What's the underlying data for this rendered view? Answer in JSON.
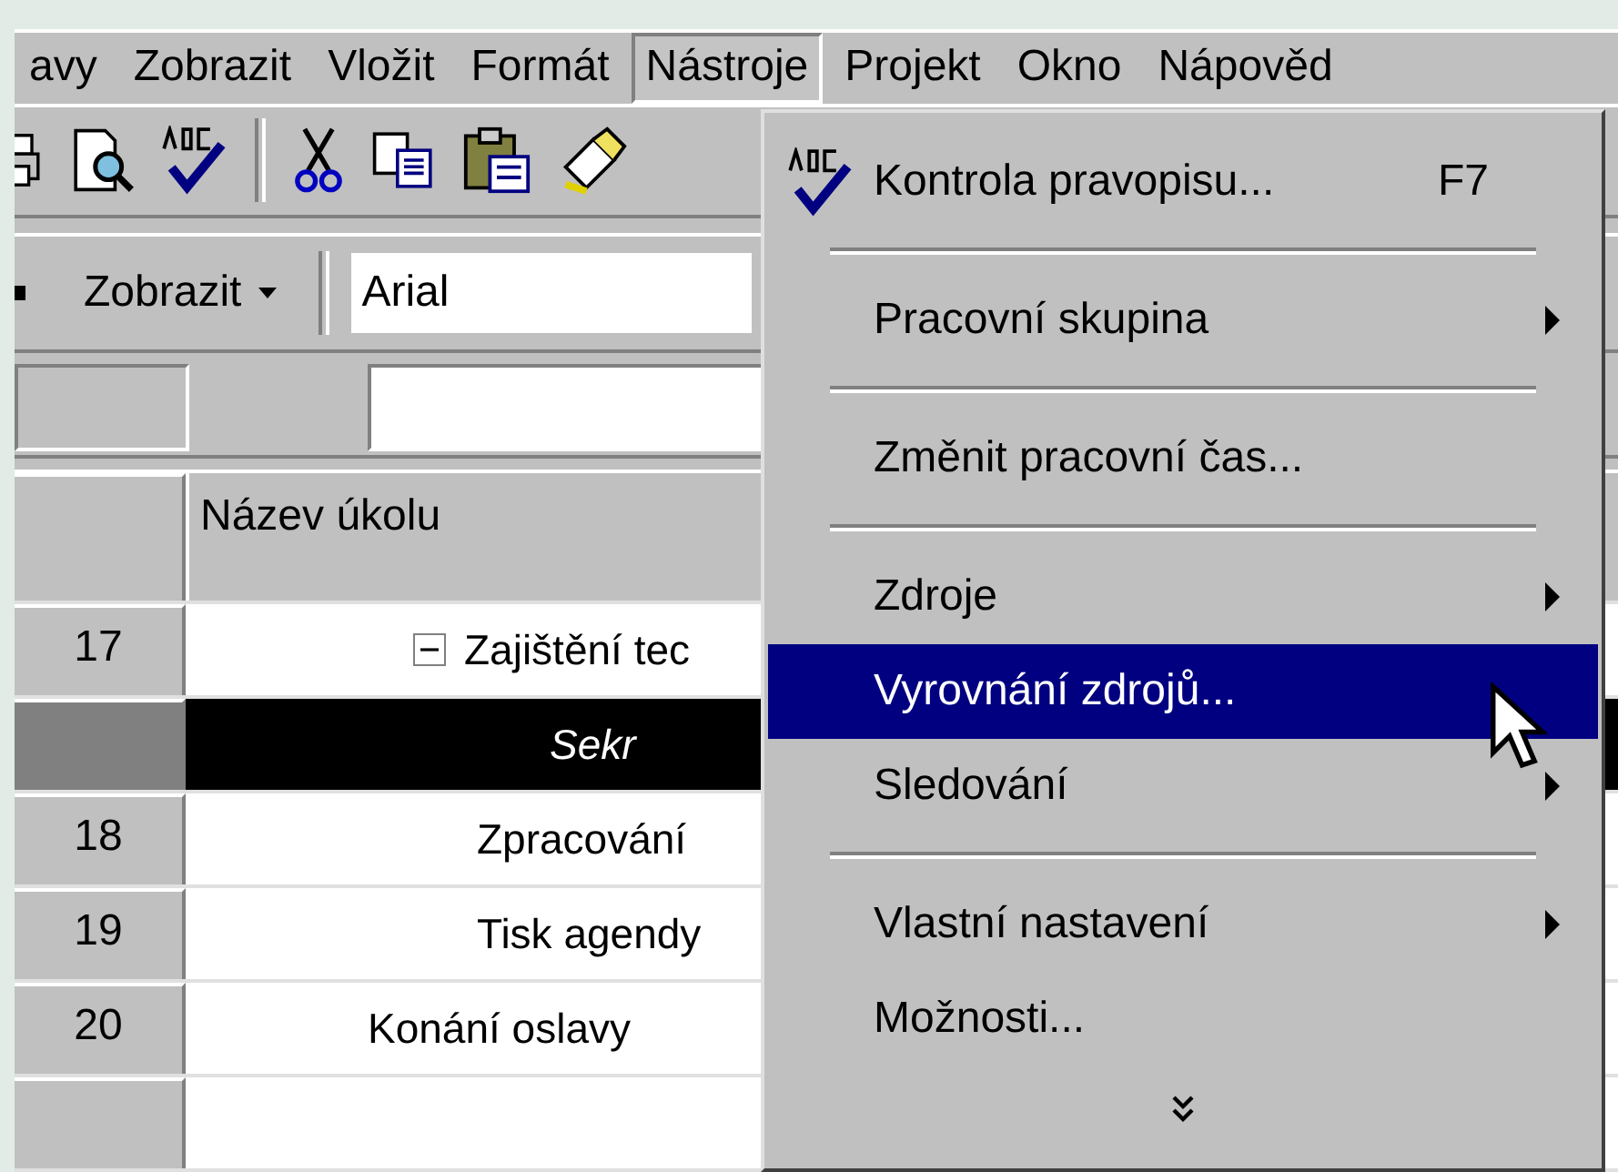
{
  "menu_bar": [
    {
      "label": "avy",
      "selected": false
    },
    {
      "label": "Zobrazit",
      "selected": false
    },
    {
      "label": "Vložit",
      "selected": false
    },
    {
      "label": "Formát",
      "selected": false
    },
    {
      "label": "Nástroje",
      "selected": true
    },
    {
      "label": "Projekt",
      "selected": false
    },
    {
      "label": "Okno",
      "selected": false
    },
    {
      "label": "Nápověd",
      "selected": false
    }
  ],
  "formatting_toolbar": {
    "view_button": "Zobrazit",
    "font_field": {
      "value": "Arial"
    }
  },
  "table": {
    "columns": [
      "Název úkolu"
    ],
    "rows": [
      {
        "id": "17",
        "name": "Zajištění tec",
        "selected": false,
        "expanded": true,
        "children": [
          {
            "name": "Sekr",
            "selected": true,
            "kind": "assignment"
          },
          {
            "id": "18",
            "name": "Zpracování",
            "selected": false
          },
          {
            "id": "19",
            "name": "Tisk agendy",
            "selected": false
          }
        ]
      },
      {
        "id": "20",
        "name": "Konání oslavy",
        "selected": false
      }
    ]
  },
  "tools_menu": {
    "items": [
      {
        "kind": "command",
        "label": "Kontrola pravopisu...",
        "shortcut": "F7",
        "icon": true,
        "selected": false
      },
      {
        "kind": "separator"
      },
      {
        "kind": "submenu",
        "label": "Pracovní skupina",
        "selected": false
      },
      {
        "kind": "separator"
      },
      {
        "kind": "command",
        "label": "Změnit pracovní čas...",
        "selected": false
      },
      {
        "kind": "separator"
      },
      {
        "kind": "submenu",
        "label": "Zdroje",
        "selected": false
      },
      {
        "kind": "command",
        "label": "Vyrovnání zdrojů...",
        "selected": true
      },
      {
        "kind": "submenu",
        "label": "Sledování",
        "selected": false
      },
      {
        "kind": "separator"
      },
      {
        "kind": "submenu",
        "label": "Vlastní nastavení",
        "selected": false
      },
      {
        "kind": "command",
        "label": "Možnosti...",
        "selected": false
      },
      {
        "kind": "more"
      }
    ]
  }
}
